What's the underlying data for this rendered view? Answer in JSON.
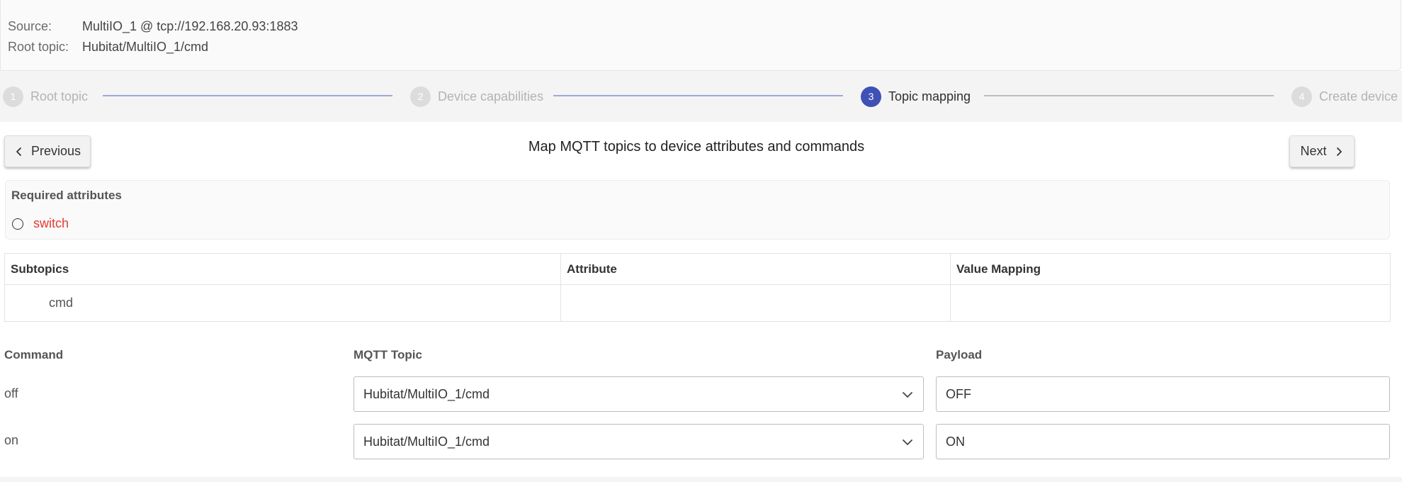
{
  "source_panel": {
    "source_label": "Source:",
    "source_value": "MultiIO_1 @ tcp://192.168.20.93:1883",
    "root_topic_label": "Root topic:",
    "root_topic_value": "Hubitat/MultiIO_1/cmd"
  },
  "stepper": {
    "steps": [
      {
        "number": "1",
        "label": "Root topic",
        "state": "completed"
      },
      {
        "number": "2",
        "label": "Device capabilities",
        "state": "completed"
      },
      {
        "number": "3",
        "label": "Topic mapping",
        "state": "active"
      },
      {
        "number": "4",
        "label": "Create device",
        "state": "pending"
      }
    ],
    "active_color": "#3f51b5",
    "completed_line_color": "#9fa8da",
    "pending_line_color": "#bdbdbd"
  },
  "nav": {
    "previous_label": "Previous",
    "next_label": "Next",
    "heading": "Map MQTT topics to device attributes and commands"
  },
  "required_attributes": {
    "title": "Required attributes",
    "items": [
      {
        "label": "switch",
        "mapped": false,
        "color": "#e53935"
      }
    ]
  },
  "subtopics_table": {
    "headers": [
      "Subtopics",
      "Attribute",
      "Value Mapping"
    ],
    "rows": [
      {
        "subtopic": "cmd",
        "attribute": "",
        "value_mapping": ""
      }
    ]
  },
  "commands": {
    "headers": {
      "command": "Command",
      "topic": "MQTT Topic",
      "payload": "Payload"
    },
    "rows": [
      {
        "command": "off",
        "topic": "Hubitat/MultiIO_1/cmd",
        "payload": "OFF"
      },
      {
        "command": "on",
        "topic": "Hubitat/MultiIO_1/cmd",
        "payload": "ON"
      }
    ]
  },
  "icons": {
    "previous": "chevron-left-icon",
    "next": "chevron-right-icon",
    "dropdown": "chevron-down-icon",
    "unchecked": "radio-unchecked-icon"
  }
}
